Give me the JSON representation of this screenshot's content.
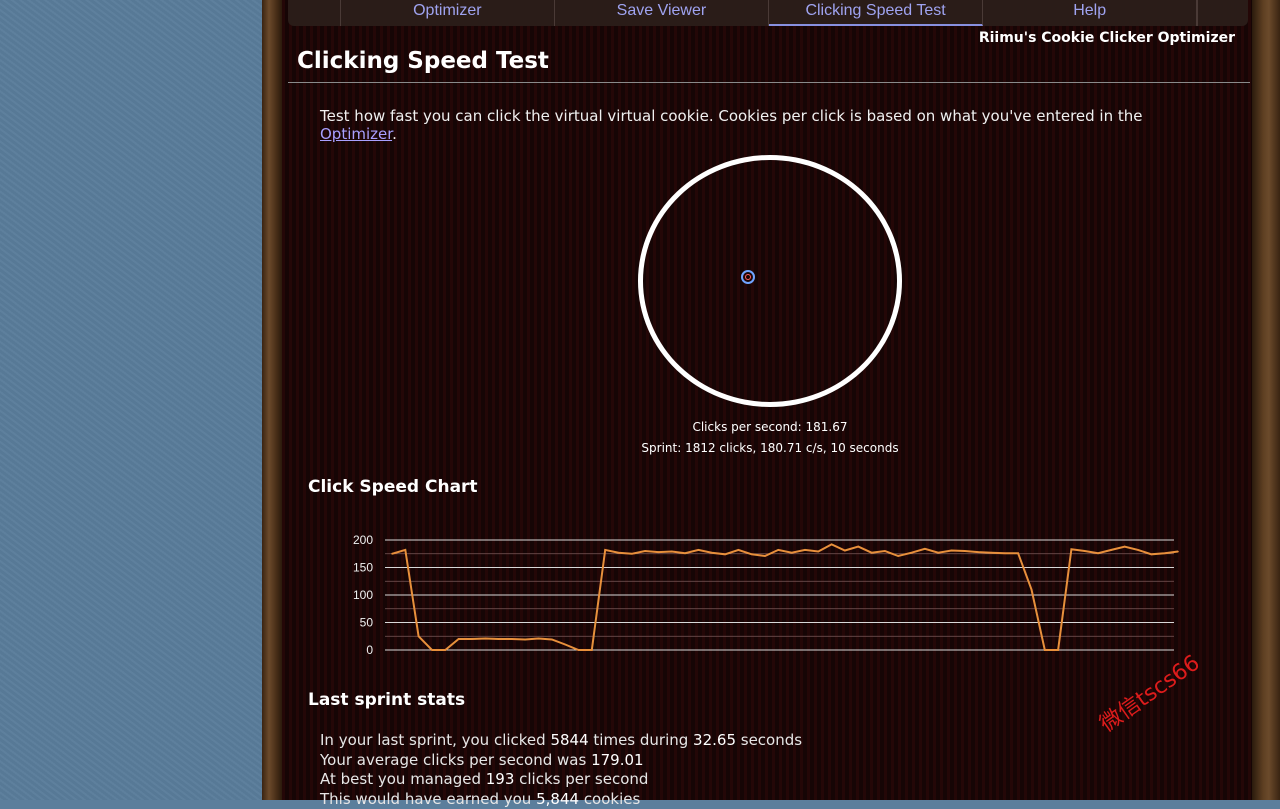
{
  "tabs": [
    {
      "label": "Optimizer"
    },
    {
      "label": "Save Viewer"
    },
    {
      "label": "Clicking Speed Test"
    },
    {
      "label": "Help"
    }
  ],
  "brand": "Riimu's Cookie Clicker Optimizer",
  "page_title": "Clicking Speed Test",
  "intro": {
    "text": "Test how fast you can click the virtual virtual cookie. Cookies per click is based on what you've entered in the ",
    "link": "Optimizer",
    "tail": "."
  },
  "clicks_per_second": "Clicks per second: 181.67",
  "sprint": "Sprint: 1812 clicks, 180.71 c/s, 10 seconds",
  "chart_section_title": "Click Speed Chart",
  "chart_data": {
    "type": "line",
    "color": "#e8903c",
    "ylim": [
      0,
      200
    ],
    "yticks": [
      0,
      50,
      100,
      150,
      200
    ],
    "values": [
      175,
      182,
      25,
      0,
      0,
      20,
      20,
      21,
      20,
      20,
      19,
      21,
      19,
      10,
      0,
      0,
      182,
      177,
      175,
      180,
      178,
      179,
      176,
      182,
      177,
      174,
      182,
      174,
      171,
      182,
      177,
      182,
      179,
      192,
      181,
      188,
      177,
      180,
      171,
      177,
      184,
      177,
      181,
      180,
      178,
      177,
      176,
      176,
      110,
      0,
      0,
      183,
      180,
      176,
      182,
      188,
      182,
      174,
      176,
      179
    ]
  },
  "stats_section_title": "Last sprint stats",
  "stats": {
    "l1_a": "In your last sprint, you clicked ",
    "l1_b": "5844",
    "l1_c": " times during ",
    "l1_d": "32.65",
    "l1_e": " seconds",
    "l2_a": "Your average clicks per second was ",
    "l2_b": "179.01",
    "l3_a": "At best you managed ",
    "l3_b": "193",
    "l3_c": " clicks per second",
    "l4_a": "This would have earned you ",
    "l4_b": "5,844",
    "l4_c": " cookies"
  },
  "watermark": "微信tscs66"
}
